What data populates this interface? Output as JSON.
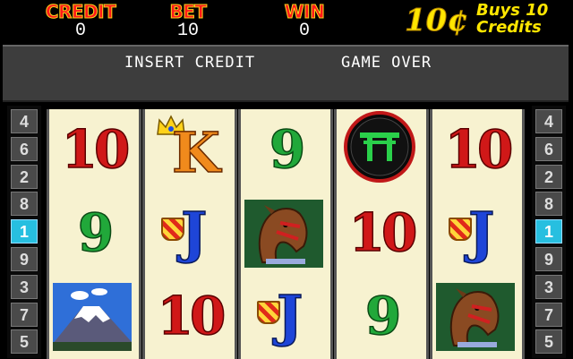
{
  "meters": {
    "credit": {
      "label": "CREDIT",
      "value": "0"
    },
    "bet": {
      "label": "BET",
      "value": "10"
    },
    "win": {
      "label": "WIN",
      "value": "0"
    }
  },
  "denomination": {
    "main": "10¢",
    "line1": "Buys 10",
    "line2": "Credits"
  },
  "messages": {
    "left": "INSERT CREDIT",
    "right": "GAME OVER"
  },
  "paylines": {
    "left": [
      "4",
      "6",
      "2",
      "8",
      "1",
      "9",
      "3",
      "7",
      "5"
    ],
    "right": [
      "4",
      "6",
      "2",
      "8",
      "1",
      "9",
      "3",
      "7",
      "5"
    ],
    "active": "1"
  },
  "reels": [
    [
      {
        "kind": "number",
        "text": "10",
        "color": "red"
      },
      {
        "kind": "number",
        "text": "9",
        "color": "green"
      },
      {
        "kind": "picture",
        "name": "mount-fuji-symbol"
      }
    ],
    [
      {
        "kind": "card",
        "text": "K",
        "color": "orange",
        "name": "king-symbol"
      },
      {
        "kind": "card",
        "text": "J",
        "color": "blue",
        "name": "jack-symbol"
      },
      {
        "kind": "number",
        "text": "10",
        "color": "red"
      }
    ],
    [
      {
        "kind": "number",
        "text": "9",
        "color": "green"
      },
      {
        "kind": "picture",
        "name": "horse-symbol"
      },
      {
        "kind": "card",
        "text": "J",
        "color": "blue",
        "name": "jack-symbol"
      }
    ],
    [
      {
        "kind": "picture",
        "name": "torii-gate-symbol"
      },
      {
        "kind": "number",
        "text": "10",
        "color": "red"
      },
      {
        "kind": "number",
        "text": "9",
        "color": "green"
      }
    ],
    [
      {
        "kind": "number",
        "text": "10",
        "color": "red"
      },
      {
        "kind": "card",
        "text": "J",
        "color": "blue",
        "name": "jack-symbol"
      },
      {
        "kind": "picture",
        "name": "horse-symbol"
      }
    ]
  ]
}
